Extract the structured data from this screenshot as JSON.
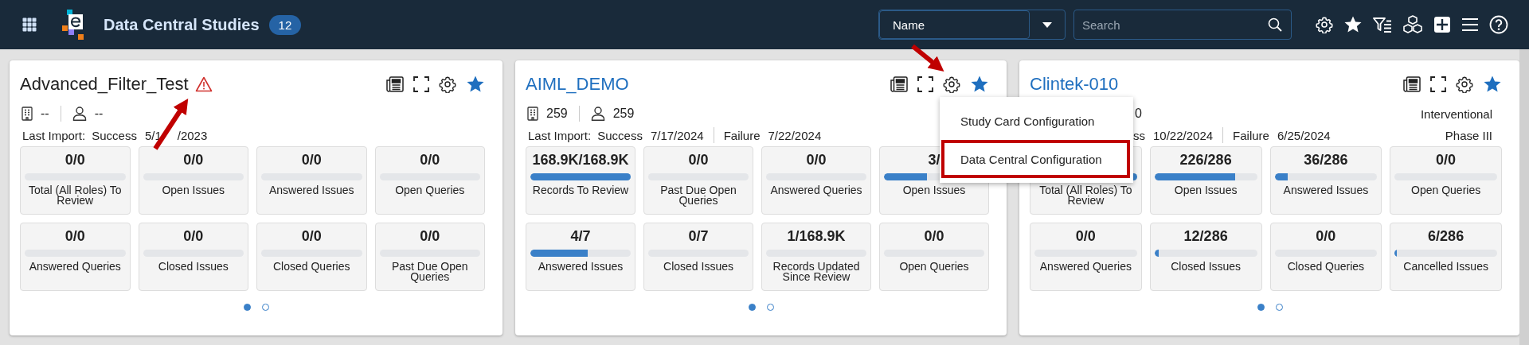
{
  "header": {
    "title": "Data Central Studies",
    "count": "12",
    "sort_select": {
      "value": "Name"
    },
    "search": {
      "placeholder": "Search"
    }
  },
  "cards": [
    {
      "title": "Advanced_Filter_Test",
      "link": false,
      "warning": true,
      "meta": [
        {
          "kind": "building",
          "value": "--"
        },
        {
          "kind": "person",
          "value": "--"
        }
      ],
      "import": {
        "label": "Last Import:",
        "entries": [
          {
            "status": "Success",
            "date": "5/1",
            "date_rest": "/2023"
          }
        ]
      },
      "tiles": [
        {
          "value": "0/0",
          "level": 0,
          "label": "Total (All Roles) To Review"
        },
        {
          "value": "0/0",
          "level": 0,
          "label": "Open Issues"
        },
        {
          "value": "0/0",
          "level": 0,
          "label": "Answered Issues"
        },
        {
          "value": "0/0",
          "level": 0,
          "label": "Open Queries"
        },
        {
          "value": "0/0",
          "level": 0,
          "label": "Answered Queries"
        },
        {
          "value": "0/0",
          "level": 0,
          "label": "Closed Issues"
        },
        {
          "value": "0/0",
          "level": 0,
          "label": "Closed Queries"
        },
        {
          "value": "0/0",
          "level": 0,
          "label": "Past Due Open Queries"
        }
      ],
      "pages": [
        {
          "selected": true
        },
        {
          "selected": false
        }
      ]
    },
    {
      "title": "AIML_DEMO",
      "link": true,
      "warning": false,
      "meta": [
        {
          "kind": "building",
          "value": "259"
        },
        {
          "kind": "person",
          "value": "259"
        }
      ],
      "import": {
        "label": "Last Import:",
        "entries": [
          {
            "status": "Success",
            "date": "7/17/2024"
          },
          {
            "status": "Failure",
            "date": "7/22/2024"
          }
        ]
      },
      "tiles": [
        {
          "value": "168.9K/168.9K",
          "level": 1,
          "label": "Records To Review"
        },
        {
          "value": "0/0",
          "level": 0,
          "label": "Past Due Open Queries"
        },
        {
          "value": "0/0",
          "level": 0,
          "label": "Answered Queries"
        },
        {
          "value": "3/",
          "level": 0.43,
          "label": "Open Issues"
        },
        {
          "value": "4/7",
          "level": 0.57,
          "label": "Answered Issues"
        },
        {
          "value": "0/7",
          "level": 0,
          "label": "Closed Issues"
        },
        {
          "value": "1/168.9K",
          "level": 0,
          "label": "Records Updated Since Review"
        },
        {
          "value": "0/0",
          "level": 0,
          "label": "Open Queries"
        }
      ],
      "pages": [
        {
          "selected": true
        },
        {
          "selected": false
        }
      ]
    },
    {
      "title": "Clintek-010",
      "link": true,
      "warning": false,
      "study_type": "Interventional",
      "phase": "Phase III",
      "meta": [
        {
          "kind": "bare",
          "value": "0"
        }
      ],
      "import": {
        "entries": [
          {
            "status": "ss",
            "date": "10/22/2024"
          },
          {
            "status": "Failure",
            "date": "6/25/2024"
          }
        ]
      },
      "tiles": [
        {
          "level": 1,
          "label": "Total (All Roles) To Review"
        },
        {
          "value": "226/286",
          "level": 0.79,
          "label": "Open Issues"
        },
        {
          "value": "36/286",
          "level": 0.126,
          "label": "Answered Issues"
        },
        {
          "value": "0/0",
          "level": 0,
          "label": "Open Queries"
        },
        {
          "value": "0/0",
          "level": 0,
          "label": "Answered Queries"
        },
        {
          "value": "12/286",
          "level": 0.042,
          "label": "Closed Issues"
        },
        {
          "value": "0/0",
          "level": 0,
          "label": "Closed Queries"
        },
        {
          "value": "6/286",
          "level": 0.021,
          "label": "Cancelled Issues"
        }
      ],
      "pages": [
        {
          "selected": true
        },
        {
          "selected": false
        }
      ]
    }
  ],
  "settings_menu": {
    "items": [
      {
        "label": "Study Card Configuration",
        "highlighted": false
      },
      {
        "label": "Data Central Configuration",
        "highlighted": true
      }
    ]
  }
}
